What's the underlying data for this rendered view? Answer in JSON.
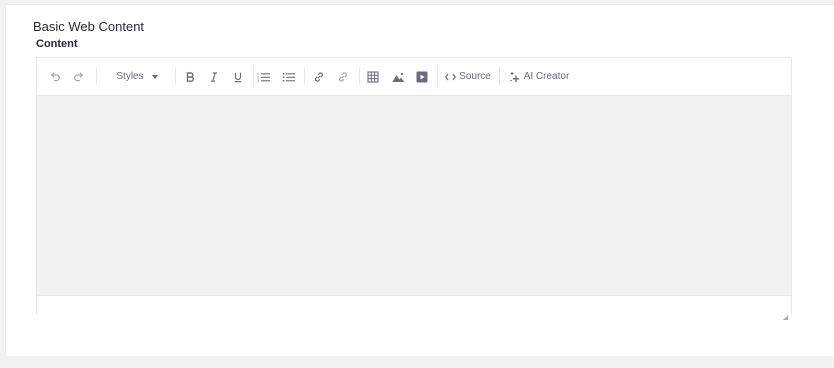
{
  "section": {
    "title": "Basic Web Content"
  },
  "field": {
    "label": "Content"
  },
  "toolbar": {
    "styles_label": "Styles",
    "source_label": "Source",
    "ai_creator_label": "AI Creator"
  },
  "colors": {
    "page_bg": "#f1f2f4",
    "panel_bg": "#ffffff",
    "edit_area_bg": "#f0f1f2",
    "icon": "#6b6c7e",
    "text": "#272833"
  },
  "icons": [
    "undo-icon",
    "redo-icon",
    "bold-icon",
    "italic-icon",
    "underline-icon",
    "numbered-list-icon",
    "bulleted-list-icon",
    "link-icon",
    "unlink-icon",
    "table-icon",
    "image-icon",
    "video-icon",
    "source-code-icon",
    "ai-sparkle-icon",
    "resize-grip-icon"
  ]
}
